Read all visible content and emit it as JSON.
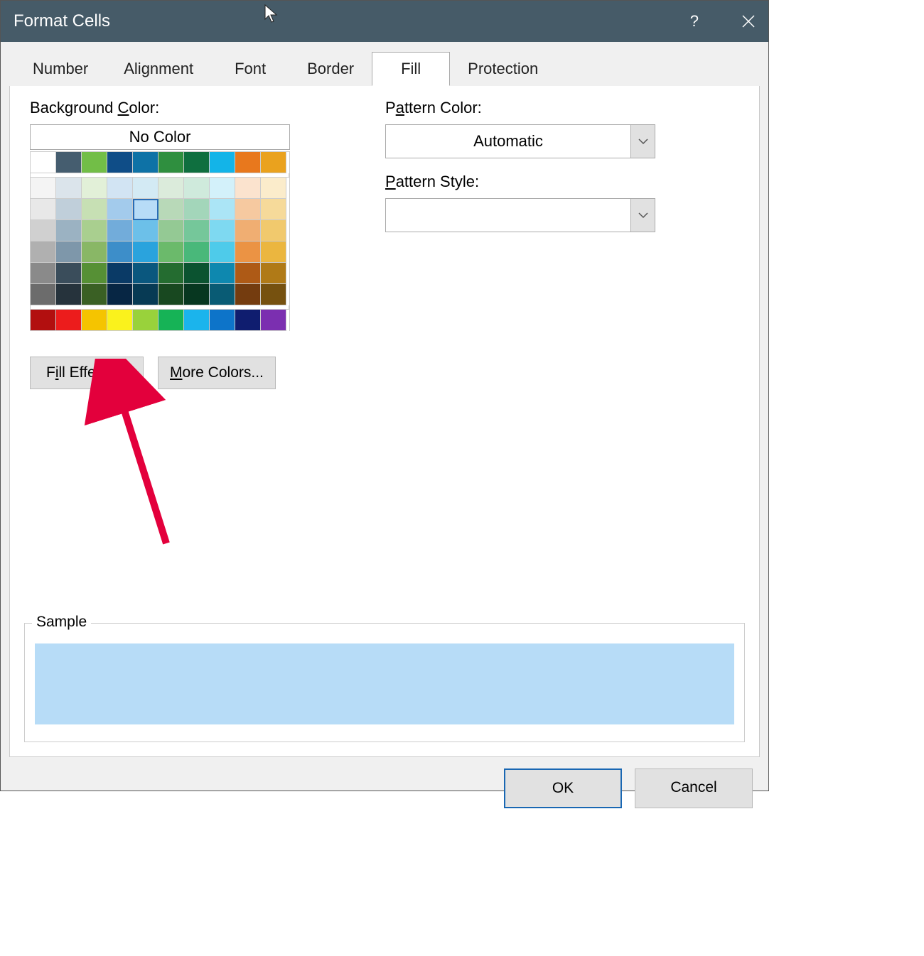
{
  "window": {
    "title": "Format Cells"
  },
  "tabs": [
    "Number",
    "Alignment",
    "Font",
    "Border",
    "Fill",
    "Protection"
  ],
  "active_tab_index": 4,
  "labels": {
    "bg_color_pre": "Background ",
    "bg_color_u": "C",
    "bg_color_post": "olor:",
    "no_color": "No Color",
    "fill_effects_pre": "F",
    "fill_effects_u": "i",
    "fill_effects_post": "ll Effects...",
    "more_colors_u": "M",
    "more_colors_post": "ore Colors...",
    "pattern_color_pre": "P",
    "pattern_color_u": "a",
    "pattern_color_post": "ttern Color:",
    "pattern_style_pre": "",
    "pattern_style_u": "P",
    "pattern_style_post": "attern Style:",
    "automatic": "Automatic",
    "sample": "Sample",
    "ok": "OK",
    "cancel": "Cancel"
  },
  "selected_color": "#b7dcf7",
  "sample_color": "#b7dcf7",
  "palette_top": [
    [
      "#ffffff",
      "#455d6f",
      "#72be47",
      "#0f4d87",
      "#0e72a6",
      "#2f8f3f",
      "#0f6f3f",
      "#13b4e8",
      "#e8781d",
      "#eaa21e"
    ]
  ],
  "palette_main": [
    [
      "#f4f4f4",
      "#dbe4eb",
      "#e2f0d8",
      "#d2e4f3",
      "#d3eaf4",
      "#dbebdb",
      "#cfeadc",
      "#d3f1fa",
      "#fbe3ce",
      "#fbeccb"
    ],
    [
      "#e8e8e8",
      "#c0cfda",
      "#c7e0b4",
      "#a3cbec",
      "#b7dcf7",
      "#b8d9b8",
      "#a3d6ba",
      "#abe5f6",
      "#f6c9a0",
      "#f6da9a"
    ],
    [
      "#d0d0d0",
      "#9bb2c2",
      "#a9cf8f",
      "#72acda",
      "#6cc0e9",
      "#94c994",
      "#75c79a",
      "#7ed9f1",
      "#f0ae72",
      "#f1c96d"
    ],
    [
      "#b0b0b0",
      "#7e97aa",
      "#89b766",
      "#3d8ec9",
      "#2aa3dd",
      "#6bba6b",
      "#49b87a",
      "#4ecbea",
      "#eb9344",
      "#ebb63f"
    ],
    [
      "#8a8a8a",
      "#3a4d5b",
      "#569035",
      "#0a3a66",
      "#0a577e",
      "#246c30",
      "#0b5330",
      "#0e88af",
      "#ae5a16",
      "#b07a17"
    ],
    [
      "#6c6c6c",
      "#26333c",
      "#3a6024",
      "#072644",
      "#073a54",
      "#184820",
      "#073720",
      "#095b74",
      "#743c0f",
      "#76510f"
    ]
  ],
  "palette_bottom": [
    [
      "#b20f0f",
      "#ec1c1c",
      "#f5c400",
      "#faf21c",
      "#99d23b",
      "#16b356",
      "#1bb4ec",
      "#0d74c9",
      "#0f1d6f",
      "#7b2fb0"
    ]
  ]
}
